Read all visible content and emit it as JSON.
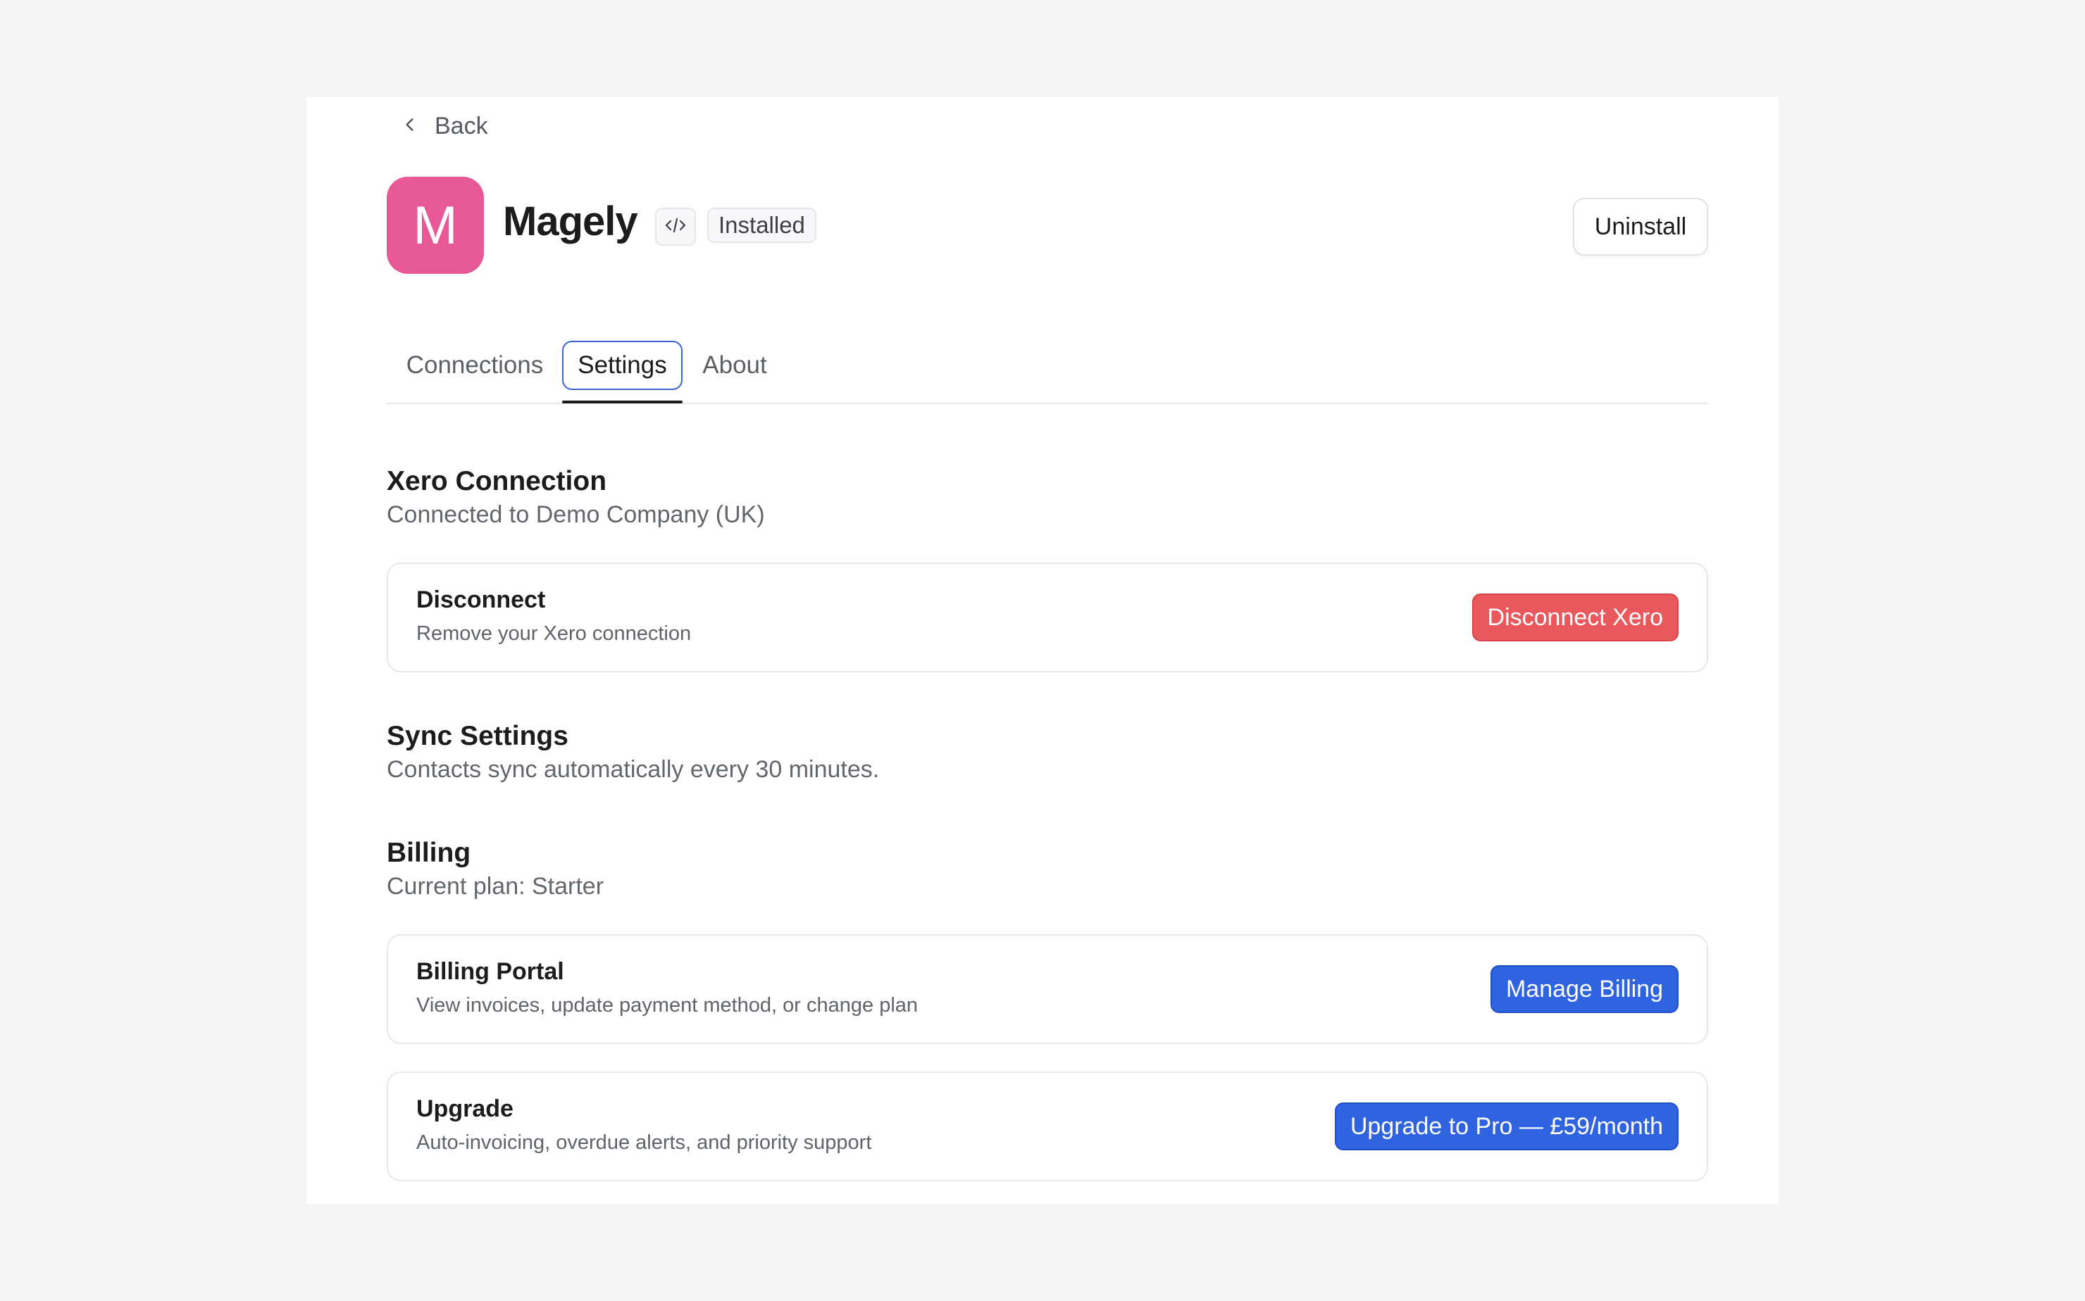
{
  "nav": {
    "back_label": "Back"
  },
  "app": {
    "logo_letter": "M",
    "name": "Magely",
    "status": "Installed",
    "uninstall_label": "Uninstall",
    "brand_color": "#e75896"
  },
  "tabs": [
    {
      "label": "Connections",
      "active": false
    },
    {
      "label": "Settings",
      "active": true
    },
    {
      "label": "About",
      "active": false
    }
  ],
  "sections": {
    "xero": {
      "title": "Xero Connection",
      "subtitle": "Connected to Demo Company (UK)",
      "card": {
        "title": "Disconnect",
        "description": "Remove your Xero connection",
        "button_label": "Disconnect Xero"
      }
    },
    "sync": {
      "title": "Sync Settings",
      "subtitle": "Contacts sync automatically every 30 minutes."
    },
    "billing": {
      "title": "Billing",
      "subtitle": "Current plan: Starter",
      "portal_card": {
        "title": "Billing Portal",
        "description": "View invoices, update payment method, or change plan",
        "button_label": "Manage Billing"
      },
      "upgrade_card": {
        "title": "Upgrade",
        "description": "Auto-invoicing, overdue alerts, and priority support",
        "button_label": "Upgrade to Pro — £59/month"
      }
    }
  },
  "colors": {
    "danger": "#e8585c",
    "primary": "#2f63e0",
    "tab_focus": "#3b63d8"
  },
  "icons": {
    "back": "chevron-left-icon",
    "code": "code-icon"
  }
}
